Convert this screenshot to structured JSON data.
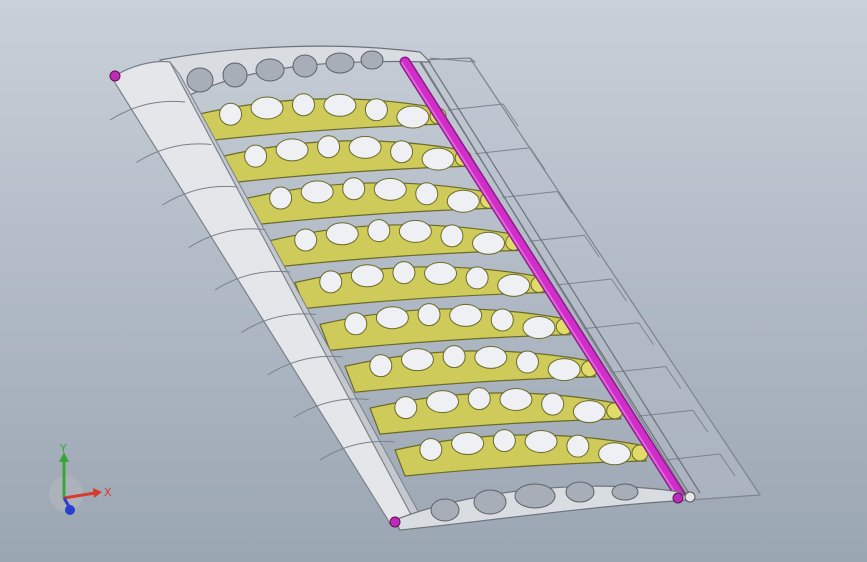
{
  "viewport": {
    "background_top": "#c9d0d9",
    "background_bottom": "#9ba6b3"
  },
  "model": {
    "rib_count": 9,
    "rib_color": "#cfcb5a",
    "rib_edge_color": "#6b6a2a",
    "spar_color": "#d02dc9",
    "skin_color": "#e4e6ea",
    "frame_color": "#8d949e"
  },
  "triad": {
    "x_label": "X",
    "y_label": "Y",
    "x_color": "#d83a2e",
    "y_color": "#3aa63a",
    "z_color": "#2a3fd0"
  }
}
